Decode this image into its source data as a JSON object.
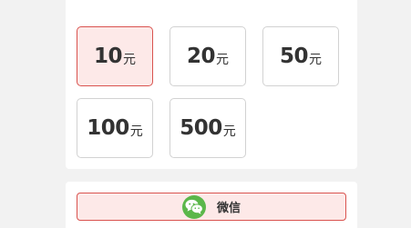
{
  "amounts": [
    {
      "value": "10",
      "unit": "元",
      "selected": true
    },
    {
      "value": "20",
      "unit": "元",
      "selected": false
    },
    {
      "value": "50",
      "unit": "元",
      "selected": false
    },
    {
      "value": "100",
      "unit": "元",
      "selected": false
    },
    {
      "value": "500",
      "unit": "元",
      "selected": false
    }
  ],
  "payment": {
    "method_label": "微信",
    "icon": "wechat-icon",
    "selected": true
  },
  "colors": {
    "accent": "#d9534f",
    "selected_bg": "#fde9e8",
    "wechat_green": "#5bb74a",
    "page_bg": "#f2f2f2"
  }
}
